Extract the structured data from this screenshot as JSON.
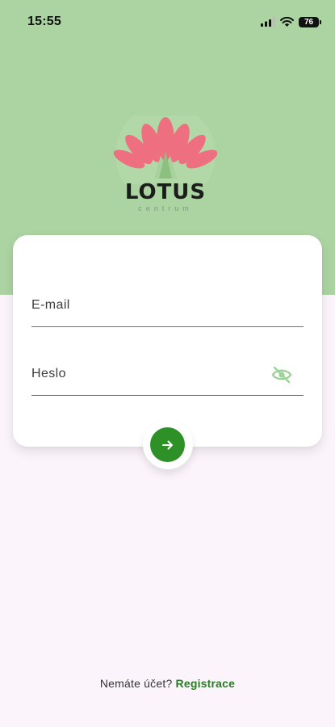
{
  "status_bar": {
    "time": "15:55",
    "battery": "76",
    "icons": [
      "signal-icon",
      "wifi-icon",
      "battery-icon"
    ]
  },
  "logo": {
    "word": "LOTUS",
    "subtitle": "centrum",
    "petal_color": "#ee6f80",
    "leaf_color": "#a9d19e"
  },
  "login_form": {
    "email_placeholder": "E-mail",
    "email_value": "",
    "password_placeholder": "Heslo",
    "password_value": "",
    "password_toggle_icon": "eye-off-icon",
    "submit_icon": "arrow-right-icon"
  },
  "footer": {
    "prompt": "Nemáte účet?",
    "register_link": "Registrace"
  },
  "colors": {
    "header_bg": "#acd4a2",
    "page_bg": "#fbf5fb",
    "accent": "#2d9128",
    "link": "#2b7a26"
  }
}
